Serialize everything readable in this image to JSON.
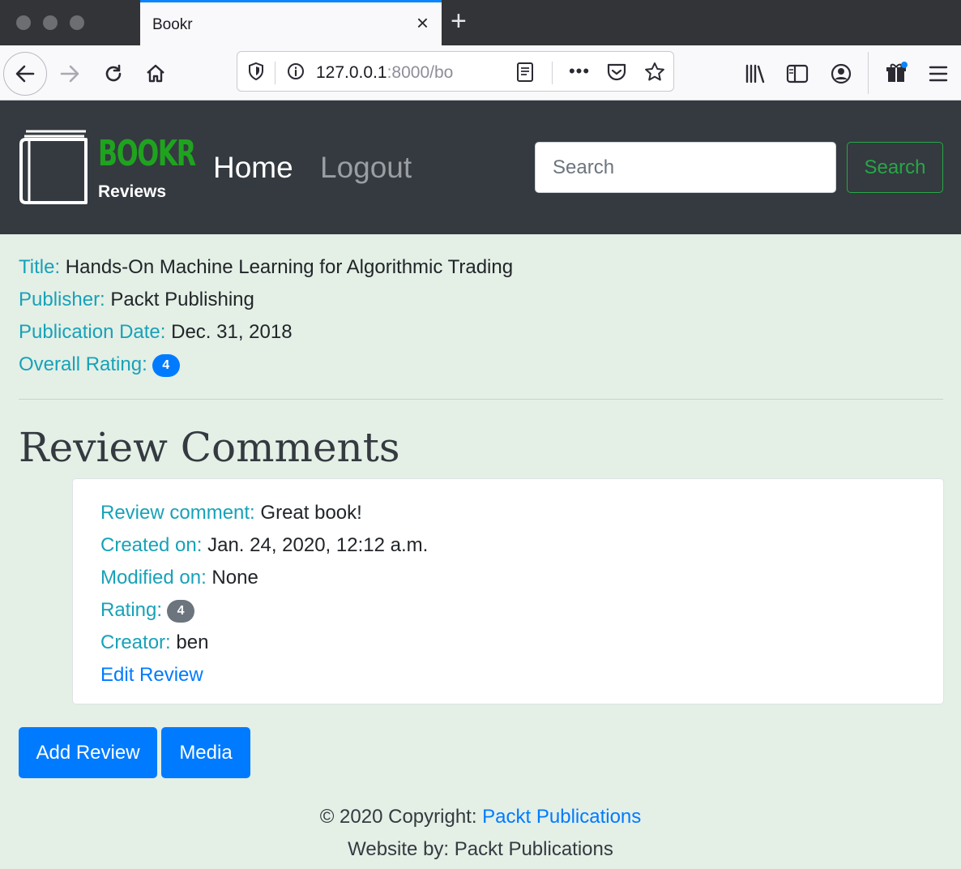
{
  "browser": {
    "tab_title": "Bookr",
    "tab_close": "×",
    "new_tab": "+",
    "url_host": "127.0.0.1",
    "url_rest": ":8000/bo"
  },
  "site": {
    "logo_word": "BOOKR",
    "logo_sub": "Reviews",
    "nav": {
      "home": "Home",
      "logout": "Logout"
    },
    "search": {
      "placeholder": "Search",
      "button": "Search"
    }
  },
  "book": {
    "fields": [
      {
        "label": "Title:",
        "value": "Hands-On Machine Learning for Algorithmic Trading"
      },
      {
        "label": "Publisher:",
        "value": "Packt Publishing"
      },
      {
        "label": "Publication Date:",
        "value": "Dec. 31, 2018"
      }
    ],
    "rating_label": "Overall Rating:",
    "rating": "4"
  },
  "reviews": {
    "heading": "Review Comments",
    "items": [
      {
        "comment_label": "Review comment:",
        "comment": "Great book!",
        "created_label": "Created on:",
        "created": "Jan. 24, 2020, 12:12 a.m.",
        "modified_label": "Modified on:",
        "modified": "None",
        "rating_label": "Rating:",
        "rating": "4",
        "creator_label": "Creator:",
        "creator": "ben",
        "edit_link": "Edit Review"
      }
    ]
  },
  "actions": {
    "add_review": "Add Review",
    "media": "Media"
  },
  "footer": {
    "copyright": "© 2020 Copyright: ",
    "copyright_link": "Packt Publications",
    "website_by": "Website by: Packt Publications"
  },
  "colors": {
    "page_bg": "#e4efe6",
    "header_bg": "#343a40",
    "label": "#17a2b8",
    "primary": "#007bff",
    "logo_green": "#1fa31f",
    "search_green": "#28a745"
  }
}
